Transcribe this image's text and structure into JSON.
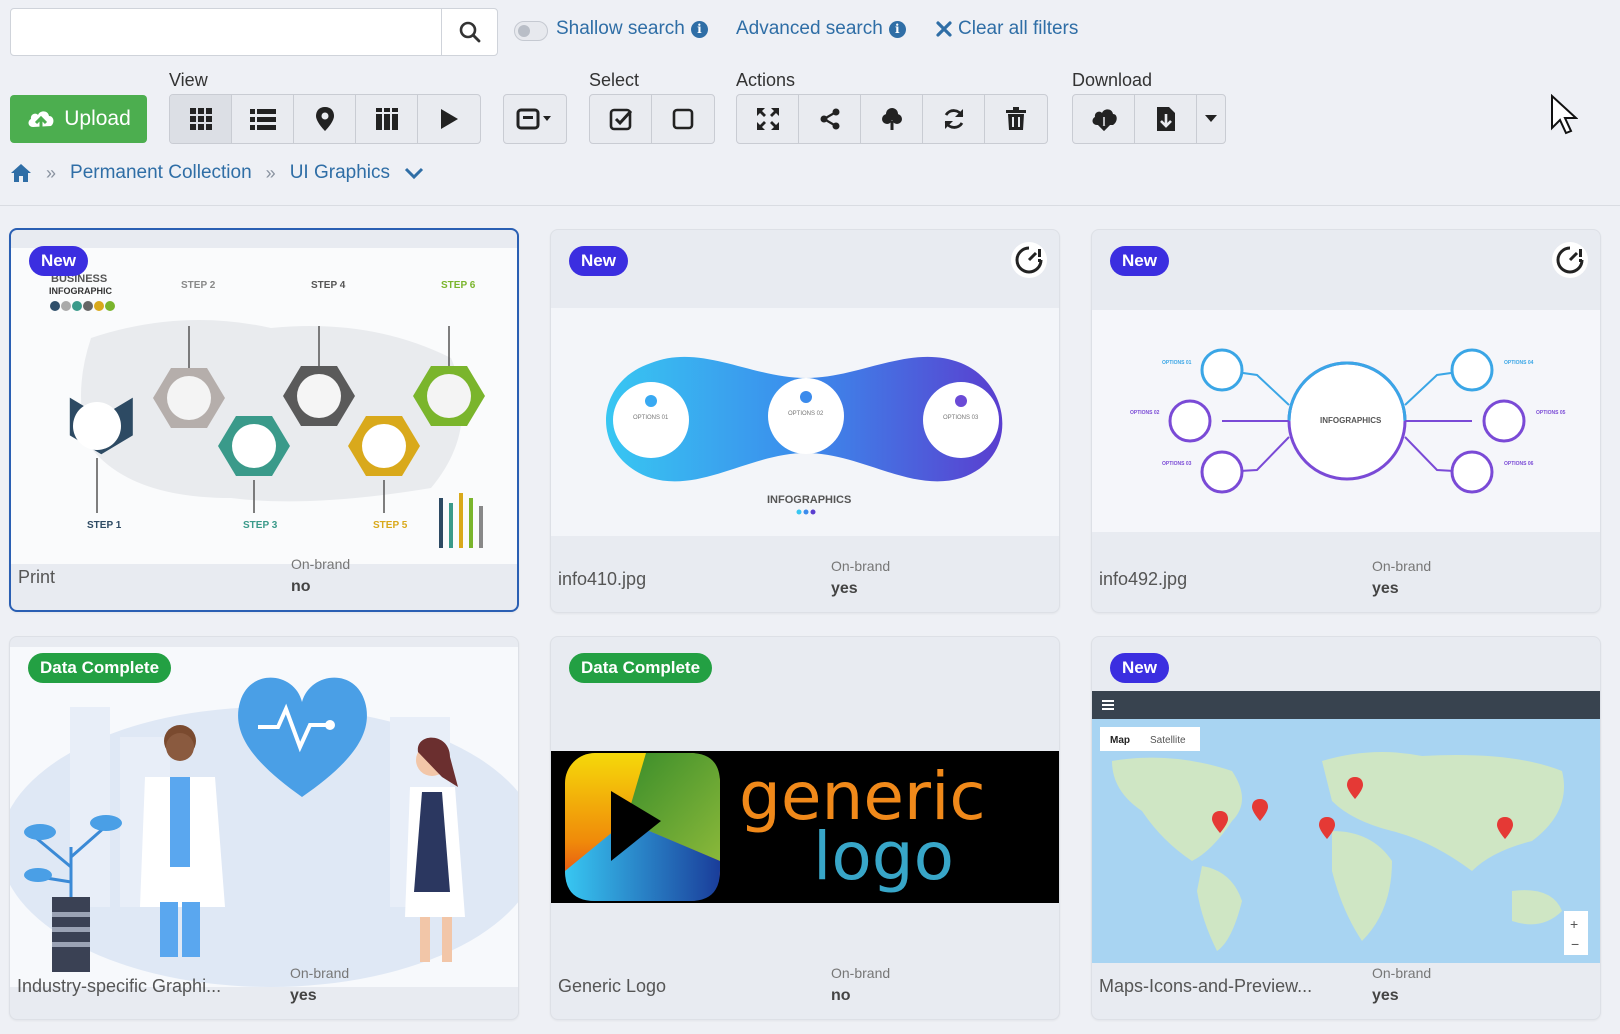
{
  "search": {
    "value": "",
    "placeholder": ""
  },
  "top_links": {
    "shallow": "Shallow search",
    "advanced": "Advanced search",
    "clear": "Clear all filters"
  },
  "toolbar": {
    "upload_label": "Upload",
    "view_label": "View",
    "select_label": "Select",
    "actions_label": "Actions",
    "download_label": "Download",
    "view_buttons": [
      "grid-icon",
      "list-icon",
      "map-pin-icon",
      "columns-icon",
      "play-icon"
    ],
    "action_buttons": [
      "expand-icon",
      "share-icon",
      "tree-icon",
      "refresh-icon",
      "trash-icon"
    ]
  },
  "breadcrumb": {
    "level1": "Permanent Collection",
    "level2": "UI Graphics"
  },
  "cards": [
    {
      "badge": "New",
      "name": "Print",
      "onbrand_label": "On-brand",
      "onbrand": "no"
    },
    {
      "badge": "New",
      "name": "info410.jpg",
      "onbrand_label": "On-brand",
      "onbrand": "yes"
    },
    {
      "badge": "New",
      "name": "info492.jpg",
      "onbrand_label": "On-brand",
      "onbrand": "yes"
    },
    {
      "badge": "Data Complete",
      "name": "Industry-specific Graphi...",
      "onbrand_label": "On-brand",
      "onbrand": "yes"
    },
    {
      "badge": "Data Complete",
      "name": "Generic Logo",
      "onbrand_label": "On-brand",
      "onbrand": "no"
    },
    {
      "badge": "New",
      "name": "Maps-Icons-and-Preview...",
      "onbrand_label": "On-brand",
      "onbrand": "yes"
    }
  ],
  "thumb_text": {
    "business": "BUSINESS",
    "infographic": "INFOGRAPHIC",
    "step1": "STEP 1",
    "step2": "STEP 2",
    "step3": "STEP 3",
    "step4": "STEP 4",
    "step5": "STEP 5",
    "step6": "STEP 6",
    "infographics": "INFOGRAPHICS",
    "options01": "OPTIONS 01",
    "options02": "OPTIONS 02",
    "options03": "OPTIONS 03",
    "options04": "OPTIONS 04",
    "options05": "OPTIONS 05",
    "options06": "OPTIONS 06",
    "logo_word1": "generic",
    "logo_word2": "logo",
    "map_tab": "Map",
    "satellite_tab": "Satellite"
  },
  "colors": {
    "accent": "#2f6ea6",
    "upload_green": "#4cae4f",
    "badge_new": "#3b2ee0",
    "badge_complete": "#23a043",
    "selected_border": "#2a5fb3"
  }
}
